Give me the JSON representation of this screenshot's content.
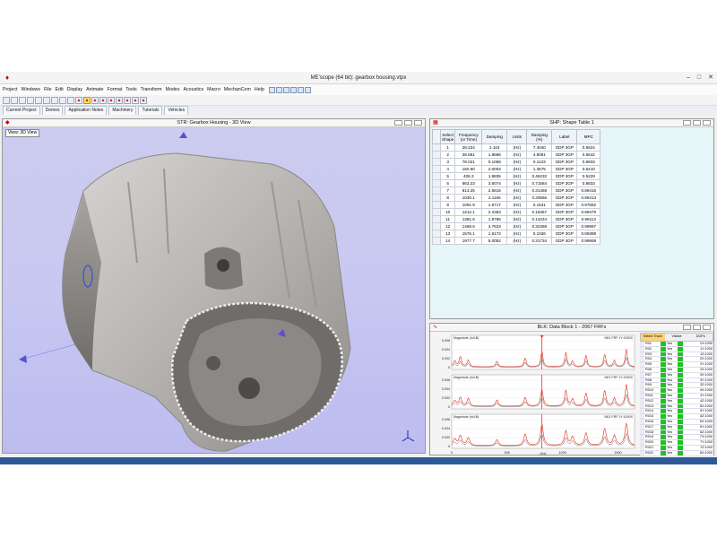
{
  "window": {
    "title": "ME'scope (64 bit): gearbox housing.vtpx"
  },
  "menu": [
    "Project",
    "Windows",
    "File",
    "Edit",
    "Display",
    "Animate",
    "Format",
    "Tools",
    "Transform",
    "Modes",
    "Acoustics",
    "Macro",
    "MechanCom",
    "Help"
  ],
  "toolbar_icons": [
    "open-icon",
    "save-icon",
    "print-icon",
    "cut-icon",
    "copy-icon",
    "paste-icon",
    "undo-icon",
    "redo-icon",
    "chart-icon",
    "zoom-icon",
    "rotate-icon",
    "pan-icon",
    "mode-icon",
    "fft-icon",
    "filter-icon",
    "measure-icon",
    "animate-icon",
    "help-icon"
  ],
  "project_tabs": [
    "Current Project",
    "Demos",
    "Application Notes",
    "Machinery",
    "Tutorials",
    "Vehicles"
  ],
  "view3d": {
    "title": "STR: Gearbox Housing - 3D View",
    "view_label": "View: 3D View"
  },
  "shape_table": {
    "title": "SHP: Shape Table 1",
    "columns": [
      "Select Shape",
      "Frequency (or Time)",
      "Damping",
      "Units",
      "Damping (%)",
      "Label",
      "MPC"
    ],
    "rows": [
      [
        "1",
        "28.224",
        "2.104",
        "(Hz)",
        "7.4040",
        "GDP 3GP",
        "0.5624"
      ],
      [
        "2",
        "38.861",
        "1.8686",
        "(Hz)",
        "4.8081",
        "GDP 3GP",
        "0.5642"
      ],
      [
        "3",
        "78.021",
        "0.1068",
        "(Hz)",
        "0.1133",
        "GDP 3GP",
        "0.8933"
      ],
      [
        "4",
        "150.60",
        "2.0004",
        "(Hz)",
        "1.3675",
        "GDP 3GP",
        "0.6410"
      ],
      [
        "5",
        "408.3",
        "1.8835",
        "(Hz)",
        "0.46232",
        "GDP 3GP",
        "0.5229"
      ],
      [
        "6",
        "663.23",
        "3.6074",
        "(Hz)",
        "0.71584",
        "GDP 3GP",
        "0.8833"
      ],
      [
        "7",
        "814.25",
        "2.5616",
        "(Hz)",
        "0.31458",
        "GDP 3GP",
        "0.99416"
      ],
      [
        "8",
        "1030.1",
        "2.1165",
        "(Hz)",
        "0.20566",
        "GDP 3GP",
        "0.96313"
      ],
      [
        "9",
        "1091.9",
        "1.6717",
        "(Hz)",
        "0.1531",
        "GDP 3GP",
        "0.97682"
      ],
      [
        "10",
        "1212.1",
        "2.2383",
        "(Hz)",
        "0.18467",
        "GDP 3GP",
        "0.99479"
      ],
      [
        "11",
        "1381.6",
        "1.9786",
        "(Hz)",
        "0.14224",
        "GDP 3GP",
        "0.99113"
      ],
      [
        "12",
        "1468.6",
        "4.7523",
        "(Hz)",
        "0.32358",
        "GDP 3GP",
        "0.99997"
      ],
      [
        "13",
        "1576.1",
        "1.6172",
        "(Hz)",
        "0.1026",
        "GDP 3GP",
        "0.99389"
      ],
      [
        "14",
        "1977.7",
        "5.0052",
        "(Hz)",
        "0.31734",
        "GDP 3GP",
        "0.99958"
      ]
    ]
  },
  "data_block": {
    "title": "BLK: Data Block 1 - 2067 FRFs",
    "traces": [
      {
        "label": "Magnitude (in/LB)",
        "id": "M01 FRF 1Y:1000X",
        "ymax": "0.006",
        "ticks": [
          "0.006",
          "0.004",
          "0.002",
          "0"
        ]
      },
      {
        "label": "Magnitude (in/LB)",
        "id": "M01 FRF 1Y:1000X",
        "ymax": "0.006",
        "ticks": [
          "0.006",
          "0.004",
          "0.002",
          "0"
        ]
      },
      {
        "label": "Magnitude (in/LB)",
        "id": "M01 FRF 1Y:1000X",
        "ymax": "0.006",
        "ticks": [
          "0.006",
          "0.004",
          "0.002",
          "0"
        ]
      }
    ],
    "xticks": [
      "0",
      "500",
      "1000",
      "1500"
    ],
    "xlabel": "(Hz)",
    "trace_cols": [
      "Select Trace",
      "Visible",
      "DOFs"
    ],
    "trace_rows": [
      [
        "R01",
        "Yes",
        "1X:1000"
      ],
      [
        "R02",
        "Yes",
        "1Y:1000"
      ],
      [
        "R03",
        "Yes",
        "1Z:1000"
      ],
      [
        "R04",
        "Yes",
        "2X:1000"
      ],
      [
        "R05",
        "Yes",
        "2Y:1000"
      ],
      [
        "R06",
        "Yes",
        "2Z:1000"
      ],
      [
        "R07",
        "Yes",
        "3X:1000"
      ],
      [
        "R08",
        "Yes",
        "3Y:1000"
      ],
      [
        "R09",
        "Yes",
        "3Z:1000"
      ],
      [
        "R010",
        "Yes",
        "4X:1000"
      ],
      [
        "R011",
        "Yes",
        "4Y:1000"
      ],
      [
        "R012",
        "Yes",
        "4Z:1000"
      ],
      [
        "R013",
        "Yes",
        "5X:1000"
      ],
      [
        "R014",
        "Yes",
        "5Y:1000"
      ],
      [
        "R015",
        "Yes",
        "5Z:1000"
      ],
      [
        "R016",
        "Yes",
        "6X:1000"
      ],
      [
        "R017",
        "Yes",
        "6Y:1000"
      ],
      [
        "R018",
        "Yes",
        "6Z:1000"
      ],
      [
        "R019",
        "Yes",
        "7X:1000"
      ],
      [
        "R020",
        "Yes",
        "7Y:1000"
      ],
      [
        "R021",
        "Yes",
        "7Z:1000"
      ],
      [
        "R022",
        "Yes",
        "8X:1000"
      ]
    ]
  },
  "colors": {
    "accent": "#2d5a97",
    "visible_green": "#22c026",
    "trace_red": "#e8301c",
    "view_bg": "#c8c8f2"
  }
}
